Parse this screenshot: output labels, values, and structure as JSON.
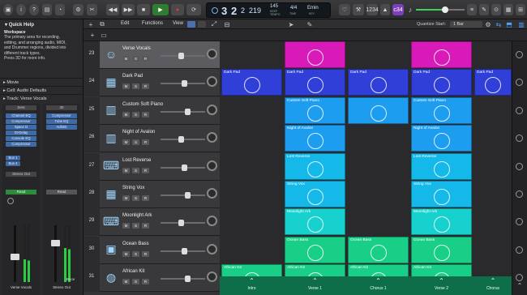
{
  "toolbar": {
    "lcd": {
      "bar": "3",
      "beat": "2",
      "div": "2",
      "tick": "219",
      "tempo": "145",
      "tempo_label": "KEEP",
      "tempo_sub": "TEMPO",
      "sig": "4/4",
      "sig_sub": "TIME",
      "key": "Emin",
      "key_sub": "KEY"
    },
    "counter": "c34"
  },
  "inspector": {
    "quick_help_title": "Quick Help",
    "workspace_title": "Workspace",
    "workspace_text": [
      "The primary area for recording,",
      "editing, and arranging audio, MIDI,",
      "and Drummer regions, divided into",
      "different track types.",
      "Press 3D for more info."
    ],
    "movie": "Movie",
    "defaults": "Cell: Audio Defaults",
    "track": "Track: Verse Vocals",
    "ch1": {
      "top": "Sent",
      "plugins": [
        "Channel EQ",
        "Compressor",
        "Space D",
        "St-Delay",
        "Console EQ",
        "Compressor"
      ],
      "sends": [
        "Bus 1",
        "Bus 4"
      ],
      "output": "Stereo Out",
      "read": "Read",
      "name": "Verse Vocals"
    },
    "ch2": {
      "top": "30",
      "plugins": [
        "Compressor",
        "Tube EQ",
        "Adlimit"
      ],
      "output": "",
      "read": "Read",
      "name": "Stereo Out",
      "meter": "Bnce"
    }
  },
  "trackhdr": {
    "menus": [
      "Edit",
      "Functions",
      "View"
    ],
    "quantize_label": "Quantize Start:",
    "quantize_value": "1 Bar"
  },
  "tracks": [
    {
      "num": "23",
      "name": "Verse Vocals",
      "icon": "person-icon",
      "selected": true
    },
    {
      "num": "24",
      "name": "Dark Pad",
      "icon": "synth-icon"
    },
    {
      "num": "25",
      "name": "Custom Soft Piano",
      "icon": "piano-icon"
    },
    {
      "num": "26",
      "name": "Night of Avalon",
      "icon": "piano-icon"
    },
    {
      "num": "27",
      "name": "Lost Reverse",
      "icon": "keyboard-icon"
    },
    {
      "num": "28",
      "name": "String Vox",
      "icon": "synth-icon"
    },
    {
      "num": "29",
      "name": "Moonlight Ark",
      "icon": "keyboard-icon"
    },
    {
      "num": "30",
      "name": "Ocean Bass",
      "icon": "amp-icon"
    },
    {
      "num": "31",
      "name": "African Kit",
      "icon": "drum-icon"
    }
  ],
  "track_buttons": {
    "mute": "M",
    "solo": "S",
    "rec": "R"
  },
  "colors": {
    "magenta": "#d81bb8",
    "blue": "#2f3fd8",
    "cyan": "#1d9df0",
    "cyan2": "#15b9e9",
    "teal": "#17d1cf",
    "green": "#19cf88",
    "scene": "#0f6e4a"
  },
  "cells": [
    {
      "row": 0,
      "col": 1,
      "label": "",
      "color": "magenta"
    },
    {
      "row": 0,
      "col": 3,
      "label": "",
      "color": "magenta"
    },
    {
      "row": 1,
      "col": 0,
      "label": "Dark Pad",
      "color": "blue"
    },
    {
      "row": 1,
      "col": 1,
      "label": "Dark Pad",
      "color": "blue"
    },
    {
      "row": 1,
      "col": 2,
      "label": "Dark Pad",
      "color": "blue"
    },
    {
      "row": 1,
      "col": 3,
      "label": "Dark Pad",
      "color": "blue"
    },
    {
      "row": 1,
      "col": 4,
      "label": "Dark Pad",
      "color": "blue"
    },
    {
      "row": 2,
      "col": 1,
      "label": "Custom Soft Piano",
      "color": "cyan"
    },
    {
      "row": 2,
      "col": 2,
      "label": "",
      "color": "cyan"
    },
    {
      "row": 2,
      "col": 3,
      "label": "Custom Soft Piano",
      "color": "cyan"
    },
    {
      "row": 3,
      "col": 1,
      "label": "Night of Avalon",
      "color": "cyan"
    },
    {
      "row": 3,
      "col": 3,
      "label": "Night of Avalon",
      "color": "cyan"
    },
    {
      "row": 4,
      "col": 1,
      "label": "Lost Reverse",
      "color": "cyan2"
    },
    {
      "row": 4,
      "col": 3,
      "label": "Lost Reverse",
      "color": "cyan2"
    },
    {
      "row": 5,
      "col": 1,
      "label": "String Vox",
      "color": "cyan2"
    },
    {
      "row": 5,
      "col": 3,
      "label": "String Vox",
      "color": "cyan2"
    },
    {
      "row": 6,
      "col": 1,
      "label": "Moonlight Ark",
      "color": "teal"
    },
    {
      "row": 6,
      "col": 3,
      "label": "Moonlight Ark",
      "color": "teal"
    },
    {
      "row": 7,
      "col": 1,
      "label": "Ocean Bass",
      "color": "green"
    },
    {
      "row": 7,
      "col": 2,
      "label": "Ocean Bass",
      "color": "green"
    },
    {
      "row": 7,
      "col": 3,
      "label": "Ocean Bass",
      "color": "green"
    },
    {
      "row": 8,
      "col": 0,
      "label": "African Kit",
      "color": "green"
    },
    {
      "row": 8,
      "col": 1,
      "label": "African Kit",
      "color": "green"
    },
    {
      "row": 8,
      "col": 2,
      "label": "African Kit",
      "color": "green"
    },
    {
      "row": 8,
      "col": 3,
      "label": "African Kit",
      "color": "green"
    }
  ],
  "scenes": [
    "Intro",
    "Verse 1",
    "Chorus 1",
    "Verse 2",
    "Chorus"
  ]
}
